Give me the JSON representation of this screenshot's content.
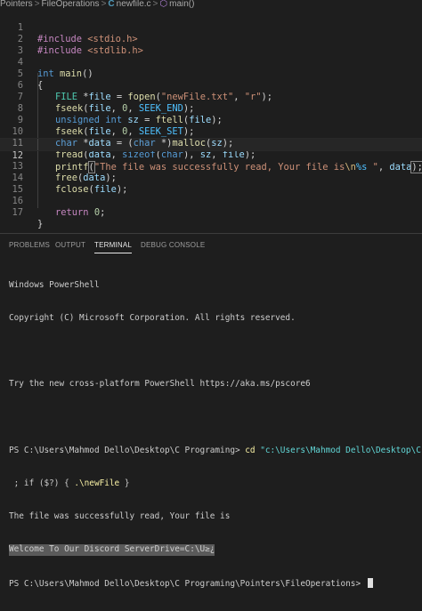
{
  "breadcrumb": {
    "folder1": "Pointers",
    "sep": ">",
    "folder2": "FileOperations",
    "file": "newfile.c",
    "symbol": "main()"
  },
  "editor": {
    "lines": [
      {
        "n": "1"
      },
      {
        "n": "2"
      },
      {
        "n": "3"
      },
      {
        "n": "4"
      },
      {
        "n": "5"
      },
      {
        "n": "6"
      },
      {
        "n": "7"
      },
      {
        "n": "8"
      },
      {
        "n": "9"
      },
      {
        "n": "10"
      },
      {
        "n": "11"
      },
      {
        "n": "12"
      },
      {
        "n": "13"
      },
      {
        "n": "14"
      },
      {
        "n": "15"
      },
      {
        "n": "16"
      },
      {
        "n": "17"
      }
    ],
    "tokens": {
      "l1": [
        "#include",
        " <stdio.h>"
      ],
      "l2": [
        "#include",
        " <stdlib.h>"
      ],
      "l4": [
        "int",
        " main",
        "()"
      ],
      "l5": [
        "{"
      ],
      "l6": [
        "FILE",
        " *",
        "file",
        " = ",
        "fopen",
        "(",
        "\"newFile.txt\"",
        ", ",
        "\"r\"",
        ");"
      ],
      "l7": [
        "fseek",
        "(",
        "file",
        ", ",
        "0",
        ", ",
        "SEEK_END",
        ");"
      ],
      "l8": [
        "unsigned",
        " int",
        " sz",
        " = ",
        "ftell",
        "(",
        "file",
        ");"
      ],
      "l9": [
        "fseek",
        "(",
        "file",
        ", ",
        "0",
        ", ",
        "SEEK_SET",
        ");"
      ],
      "l10": [
        "char",
        " *",
        "data",
        " = (",
        "char",
        " *)",
        "malloc",
        "(",
        "sz",
        ");"
      ],
      "l11": [
        "fread",
        "(",
        "data",
        ", ",
        "sizeof",
        "(",
        "char",
        "), ",
        "sz",
        ", ",
        "file",
        ");"
      ],
      "l12": [
        "printf",
        "(",
        "\"The file was successfully read, Your file is",
        "\\n",
        "%s",
        " \"",
        ", ",
        "data",
        ");"
      ],
      "l13": [
        "free",
        "(",
        "data",
        ");"
      ],
      "l14": [
        "fclose",
        "(",
        "file",
        ");"
      ],
      "l16": [
        "return",
        " ",
        "0",
        ";"
      ],
      "l17": [
        "}"
      ]
    }
  },
  "panel": {
    "tabs": [
      "PROBLEMS",
      "OUTPUT",
      "TERMINAL",
      "DEBUG CONSOLE"
    ],
    "active_tab": "TERMINAL",
    "terminal": {
      "line1": "Windows PowerShell",
      "line2": "Copyright (C) Microsoft Corporation. All rights reserved.",
      "line3": "",
      "line4": "Try the new cross-platform PowerShell https://aka.ms/pscore6",
      "line5": "",
      "prompt1": "PS C:\\Users\\Mahmod Dello\\Desktop\\C Programing> ",
      "cmd1_cd": "cd",
      "cmd1_path": " \"c:\\Users\\Mahmod Dello\\Desktop\\C Programing\\Pointers\\FileO",
      "cmd2_a": " ; if ($?) { ",
      "cmd2_b": ".\\newFile",
      "cmd2_c": " }",
      "out1": "The file was successfully read, Your file is",
      "out2": "Welcome To Our Discord ServerDrive=C:\\U≥¿",
      "prompt2": "PS C:\\Users\\Mahmod Dello\\Desktop\\C Programing\\Pointers\\FileOperations> "
    }
  },
  "colors": {
    "background": "#1e1e1e",
    "keyword": "#569cd6",
    "string": "#ce9178",
    "function": "#dcdcaa",
    "variable": "#9cdcfe",
    "type": "#4ec9b0",
    "number": "#b5cea8"
  }
}
